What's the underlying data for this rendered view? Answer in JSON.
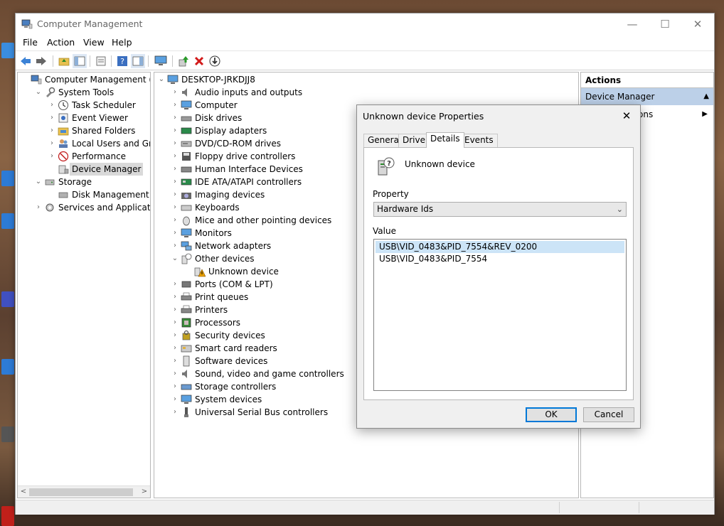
{
  "window": {
    "title": "Computer Management",
    "minimize": "—",
    "maximize": "☐",
    "close": "✕"
  },
  "menu": [
    "File",
    "Action",
    "View",
    "Help"
  ],
  "left_tree": [
    {
      "label": "Computer Management (Local",
      "level": 0,
      "expander": "",
      "icon": "computer-management-icon"
    },
    {
      "label": "System Tools",
      "level": 1,
      "expander": "⌄",
      "icon": "tools-icon"
    },
    {
      "label": "Task Scheduler",
      "level": 2,
      "expander": "›",
      "icon": "clock-icon"
    },
    {
      "label": "Event Viewer",
      "level": 2,
      "expander": "›",
      "icon": "event-viewer-icon"
    },
    {
      "label": "Shared Folders",
      "level": 2,
      "expander": "›",
      "icon": "shared-folder-icon"
    },
    {
      "label": "Local Users and Groups",
      "level": 2,
      "expander": "›",
      "icon": "users-icon"
    },
    {
      "label": "Performance",
      "level": 2,
      "expander": "›",
      "icon": "performance-icon"
    },
    {
      "label": "Device Manager",
      "level": 2,
      "expander": "",
      "icon": "device-manager-icon",
      "selected": true
    },
    {
      "label": "Storage",
      "level": 1,
      "expander": "⌄",
      "icon": "storage-icon"
    },
    {
      "label": "Disk Management",
      "level": 2,
      "expander": "",
      "icon": "disk-icon"
    },
    {
      "label": "Services and Applications",
      "level": 1,
      "expander": "›",
      "icon": "services-icon"
    }
  ],
  "device_tree": [
    {
      "label": "DESKTOP-JRKDJJ8",
      "level": 0,
      "expander": "⌄",
      "icon": "computer-icon"
    },
    {
      "label": "Audio inputs and outputs",
      "level": 1,
      "expander": "›",
      "icon": "speaker-icon"
    },
    {
      "label": "Computer",
      "level": 1,
      "expander": "›",
      "icon": "monitor-icon"
    },
    {
      "label": "Disk drives",
      "level": 1,
      "expander": "›",
      "icon": "disk-drive-icon"
    },
    {
      "label": "Display adapters",
      "level": 1,
      "expander": "›",
      "icon": "display-adapter-icon"
    },
    {
      "label": "DVD/CD-ROM drives",
      "level": 1,
      "expander": "›",
      "icon": "dvd-icon"
    },
    {
      "label": "Floppy drive controllers",
      "level": 1,
      "expander": "›",
      "icon": "floppy-icon"
    },
    {
      "label": "Human Interface Devices",
      "level": 1,
      "expander": "›",
      "icon": "hid-icon"
    },
    {
      "label": "IDE ATA/ATAPI controllers",
      "level": 1,
      "expander": "›",
      "icon": "ide-icon"
    },
    {
      "label": "Imaging devices",
      "level": 1,
      "expander": "›",
      "icon": "camera-icon"
    },
    {
      "label": "Keyboards",
      "level": 1,
      "expander": "›",
      "icon": "keyboard-icon"
    },
    {
      "label": "Mice and other pointing devices",
      "level": 1,
      "expander": "›",
      "icon": "mouse-icon"
    },
    {
      "label": "Monitors",
      "level": 1,
      "expander": "›",
      "icon": "monitor-icon"
    },
    {
      "label": "Network adapters",
      "level": 1,
      "expander": "›",
      "icon": "network-icon"
    },
    {
      "label": "Other devices",
      "level": 1,
      "expander": "⌄",
      "icon": "unknown-device-icon"
    },
    {
      "label": "Unknown device",
      "level": 2,
      "expander": "",
      "icon": "warning-device-icon"
    },
    {
      "label": "Ports (COM & LPT)",
      "level": 1,
      "expander": "›",
      "icon": "port-icon"
    },
    {
      "label": "Print queues",
      "level": 1,
      "expander": "›",
      "icon": "printer-icon"
    },
    {
      "label": "Printers",
      "level": 1,
      "expander": "›",
      "icon": "printer-icon"
    },
    {
      "label": "Processors",
      "level": 1,
      "expander": "›",
      "icon": "cpu-icon"
    },
    {
      "label": "Security devices",
      "level": 1,
      "expander": "›",
      "icon": "security-icon"
    },
    {
      "label": "Smart card readers",
      "level": 1,
      "expander": "›",
      "icon": "smartcard-icon"
    },
    {
      "label": "Software devices",
      "level": 1,
      "expander": "›",
      "icon": "software-device-icon"
    },
    {
      "label": "Sound, video and game controllers",
      "level": 1,
      "expander": "›",
      "icon": "speaker-icon"
    },
    {
      "label": "Storage controllers",
      "level": 1,
      "expander": "›",
      "icon": "storage-controller-icon"
    },
    {
      "label": "System devices",
      "level": 1,
      "expander": "›",
      "icon": "system-device-icon"
    },
    {
      "label": "Universal Serial Bus controllers",
      "level": 1,
      "expander": "›",
      "icon": "usb-icon"
    }
  ],
  "actions": {
    "header": "Actions",
    "main_item": "Device Manager",
    "sub_item": "ons"
  },
  "dialog": {
    "title": "Unknown device Properties",
    "close": "✕",
    "tabs": [
      "General",
      "Driver",
      "Details",
      "Events"
    ],
    "active_tab": "Details",
    "device_name": "Unknown device",
    "property_label": "Property",
    "property_value": "Hardware Ids",
    "value_label": "Value",
    "values": [
      "USB\\VID_0483&PID_7554&REV_0200",
      "USB\\VID_0483&PID_7554"
    ],
    "ok": "OK",
    "cancel": "Cancel"
  },
  "colors": {
    "selection": "#cce4f7",
    "actions_highlight": "#bcd0e8",
    "default_button_border": "#0078d7",
    "warning": "#e8a000"
  }
}
